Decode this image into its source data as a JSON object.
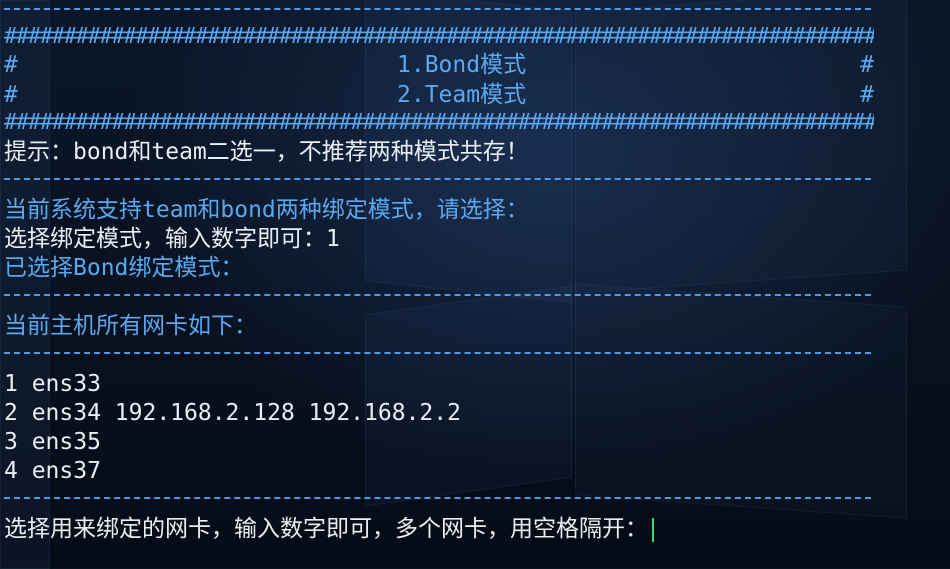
{
  "banner": {
    "hash_char": "#",
    "hash_bar": "##############################################################################################",
    "menu_items": [
      {
        "label": "1.Bond模式"
      },
      {
        "label": "2.Team模式"
      }
    ]
  },
  "lines": {
    "hint": "提示：bond和team二选一，不推荐两种模式共存！",
    "support_notice": "当前系统支持team和bond两种绑定模式，请选择：",
    "select_mode_prompt": "选择绑定模式，输入数字即可：",
    "select_mode_input": "1",
    "selected_notice": "已选择Bond绑定模式：",
    "nic_list_header": "当前主机所有网卡如下：",
    "nic_select_prompt": "选择用来绑定的网卡，输入数字即可，多个网卡，用空格隔开："
  },
  "nics": [
    {
      "text": "1 ens33"
    },
    {
      "text": "2 ens34 192.168.2.128 192.168.2.2"
    },
    {
      "text": "3 ens35"
    },
    {
      "text": "4 ens37"
    }
  ],
  "colors": {
    "accent_blue": "#5aa8f0",
    "text_white": "#e9eef4",
    "cursor_green": "#3ee06a",
    "background": "#07101e"
  }
}
